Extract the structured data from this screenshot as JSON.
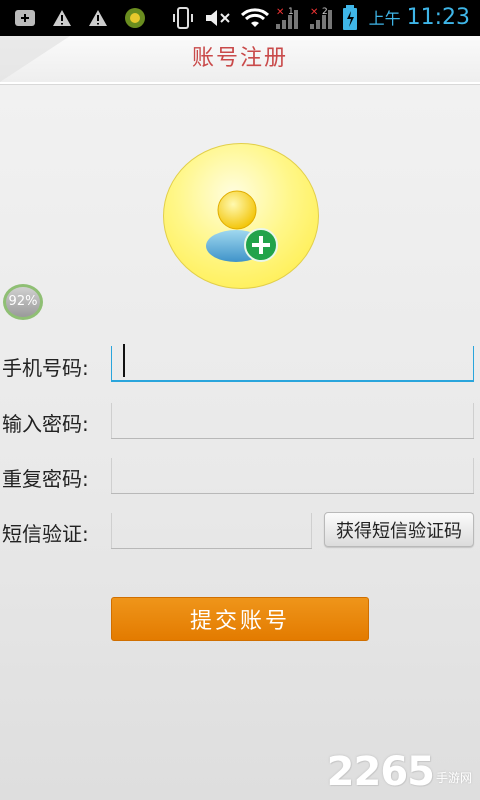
{
  "status_bar": {
    "icons": [
      "add-notification-icon",
      "warning-icon",
      "warning-icon",
      "app-green-icon",
      "vibrate-icon",
      "mute-icon",
      "wifi-icon",
      "signal-1-icon",
      "signal-2-icon",
      "battery-charging-icon"
    ],
    "ampm": "上午",
    "time": "11:23"
  },
  "header": {
    "title": "账号注册"
  },
  "progress": {
    "text": "92%",
    "value": 0.92
  },
  "form": {
    "phone_label": "手机号码:",
    "password_label": "输入密码:",
    "repeat_password_label": "重复密码:",
    "sms_label": "短信验证:",
    "phone_value": "",
    "password_value": "",
    "repeat_password_value": "",
    "sms_value": "",
    "get_code_button": "获得短信验证码"
  },
  "submit_button": "提交账号",
  "watermark": {
    "number": "2265",
    "site": "手游网"
  },
  "colors": {
    "accent": "#2aa5dc",
    "submit": "#e98a10",
    "title": "#c94a4a"
  }
}
